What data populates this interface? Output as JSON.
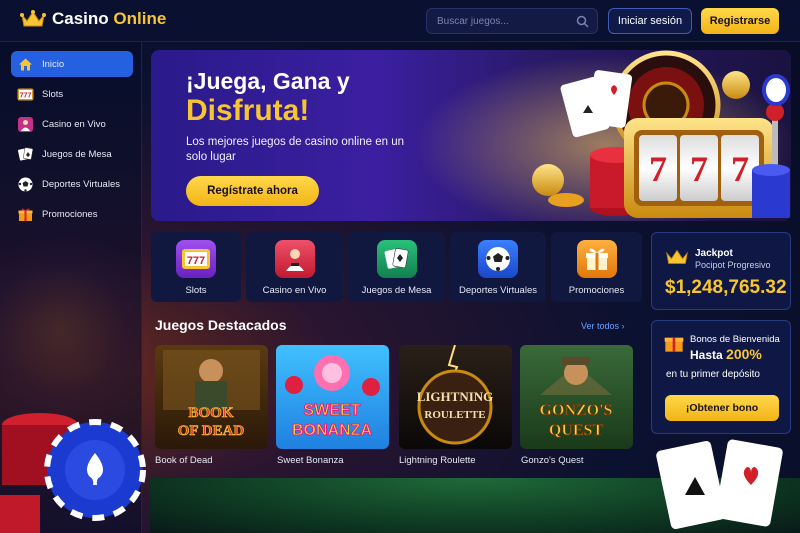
{
  "header": {
    "logo_text": "Casino",
    "logo_accent": "Online",
    "search_placeholder": "Buscar juegos...",
    "login_label": "Iniciar sesión",
    "register_label": "Registrarse"
  },
  "sidebar": {
    "items": [
      {
        "label": "Inicio",
        "icon": "home-icon",
        "active": true
      },
      {
        "label": "Slots",
        "icon": "slots-icon"
      },
      {
        "label": "Casino en Vivo",
        "icon": "live-dealer-icon"
      },
      {
        "label": "Juegos de Mesa",
        "icon": "cards-icon"
      },
      {
        "label": "Deportes Virtuales",
        "icon": "soccer-ball-icon"
      },
      {
        "label": "Promociones",
        "icon": "gift-icon"
      }
    ]
  },
  "hero": {
    "title_line1": "¡Juega, Gana y",
    "title_line2": "Disfruta!",
    "subtitle": "Los mejores juegos de casino online en un solo lugar",
    "cta_label": "Regístrate ahora",
    "slot_digits": "777"
  },
  "categories": [
    {
      "label": "Slots",
      "icon": "slots-icon",
      "color": "#8b3fe0"
    },
    {
      "label": "Casino en Vivo",
      "icon": "live-dealer-icon",
      "color": "#e0334a"
    },
    {
      "label": "Juegos de Mesa",
      "icon": "cards-icon",
      "color": "#1aa86a"
    },
    {
      "label": "Deportes Virtuales",
      "icon": "soccer-ball-icon",
      "color": "#2a6cf0"
    },
    {
      "label": "Promociones",
      "icon": "gift-icon",
      "color": "#f59a1a"
    }
  ],
  "jackpot": {
    "title": "Jackpot",
    "subtitle": "Pocipot Progresivo",
    "amount": "$1,248,765.32"
  },
  "featured": {
    "title": "Juegos Destacados",
    "see_all": "Ver todos",
    "games": [
      {
        "name": "Book of Dead",
        "art_line1": "BOOK",
        "art_line2": "OF DEAD"
      },
      {
        "name": "Sweet Bonanza",
        "art_line1": "SWEET",
        "art_line2": "BONANZA"
      },
      {
        "name": "Lightning Roulette",
        "art_line1": "LIGHTNING",
        "art_line2": "ROULETTE"
      },
      {
        "name": "Gonzo's Quest",
        "art_line1": "GONZO'S",
        "art_line2": "QUEST"
      }
    ]
  },
  "bonus": {
    "line1": "Bonos de Bienvenida",
    "line2_prefix": "Hasta",
    "line2_pct": "200%",
    "line3": "en tu primer depósito",
    "cta_label": "¡Obtener bono"
  },
  "colors": {
    "accent_gold": "#f7c531",
    "primary_blue": "#2560e0",
    "background": "#0b1130"
  }
}
